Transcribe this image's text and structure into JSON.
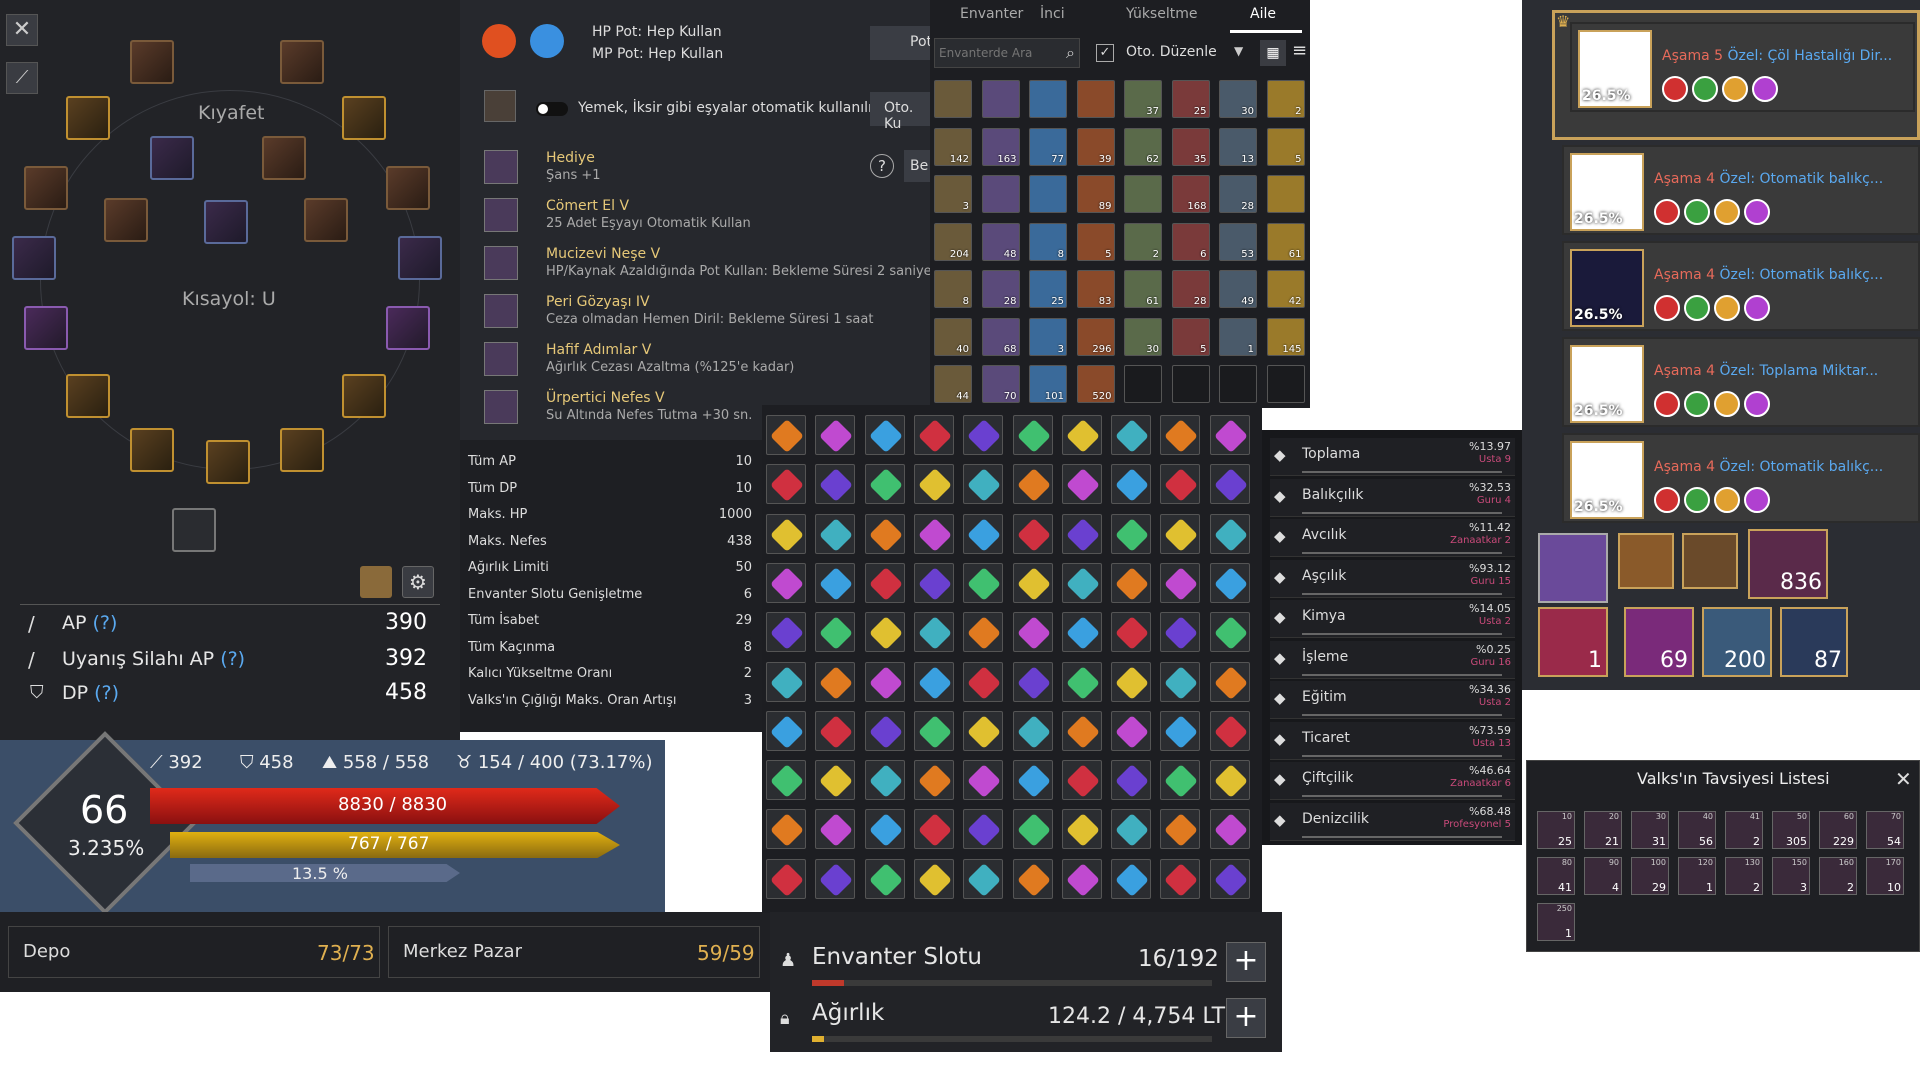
{
  "equipment": {
    "title": "Kıyafet",
    "shortcut": "Kısayol: U"
  },
  "stats": {
    "ap_label": "AP",
    "ap_help": "(?)",
    "ap": "390",
    "awake_label": "Uyanış Silahı AP",
    "awake_help": "(?)",
    "awake": "392",
    "dp_label": "DP",
    "dp_help": "(?)",
    "dp": "458"
  },
  "character": {
    "level": "66",
    "exp": "3.235%",
    "ap": "392",
    "dp": "458",
    "weight": "558 / 558",
    "energy": "154 / 400 (73.17%)",
    "hp": "8830 / 8830",
    "mp": "767 / 767",
    "sub": "13.5 %"
  },
  "storage": {
    "depo_label": "Depo",
    "depo_count": "73/73",
    "market_label": "Merkez Pazar",
    "market_count": "59/59"
  },
  "potion": {
    "hp": "HP Pot: Hep Kullan",
    "mp": "MP Pot: Hep Kullan",
    "pot_button": "Pot",
    "auto_text": "Yemek, İksir gibi eşyalar otomatik kullanılır.",
    "auto_button": "Oto. Ku",
    "help": "?",
    "bec_button": "Be"
  },
  "buffs": [
    {
      "title": "Hediye",
      "desc": "Şans +1"
    },
    {
      "title": "Cömert El V",
      "desc": "25 Adet Eşyayı Otomatik Kullan"
    },
    {
      "title": "Mucizevi Neşe V",
      "desc": "HP/Kaynak Azaldığında Pot Kullan: Bekleme Süresi 2 saniye"
    },
    {
      "title": "Peri Gözyaşı IV",
      "desc": "Ceza olmadan Hemen Diril: Bekleme Süresi 1 saat"
    },
    {
      "title": "Hafif Adımlar V",
      "desc": "Ağırlık Cezası Azaltma (%125'e kadar)"
    },
    {
      "title": "Ürpertici Nefes V",
      "desc": "Su Altında Nefes Tutma +30 sn."
    }
  ],
  "family_stats": [
    {
      "label": "Tüm AP",
      "value": "10"
    },
    {
      "label": "Tüm DP",
      "value": "10"
    },
    {
      "label": "Maks. HP",
      "value": "1000"
    },
    {
      "label": "Maks. Nefes",
      "value": "438"
    },
    {
      "label": "Ağırlık Limiti",
      "value": "50"
    },
    {
      "label": "Envanter Slotu Genişletme",
      "value": "6"
    },
    {
      "label": "Tüm İsabet",
      "value": "29"
    },
    {
      "label": "Tüm Kaçınma",
      "value": "8"
    },
    {
      "label": "Kalıcı Yükseltme Oranı",
      "value": "2"
    },
    {
      "label": "Valks'ın Çığlığı Maks. Oran Artışı",
      "value": "3"
    }
  ],
  "inventory": {
    "tabs": [
      "Envanter",
      "İnci",
      "Yükseltme",
      "Aile"
    ],
    "search_placeholder": "Envanterde Ara",
    "auto_sort": "Oto. Düzenle",
    "counts": [
      "",
      "",
      "",
      "",
      "37",
      "25",
      "30",
      "2",
      "142",
      "163",
      "77",
      "39",
      "62",
      "35",
      "13",
      "5",
      "3",
      "",
      "",
      "89",
      "",
      "168",
      "28",
      "",
      "204",
      "48",
      "8",
      "5",
      "2",
      "6",
      "53",
      "61",
      "8",
      "28",
      "25",
      "83",
      "61",
      "28",
      "49",
      "42",
      "40",
      "68",
      "3",
      "296",
      "30",
      "5",
      "1",
      "145",
      "44",
      "70",
      "101",
      "520"
    ],
    "slot_label": "Envanter Slotu",
    "slot_value": "16/192",
    "weight_label": "Ağırlık",
    "weight_value": "124.2 / 4,754 LT"
  },
  "life_skills": [
    {
      "name": "Toplama",
      "pct": "%13.97",
      "rank": "Usta 9"
    },
    {
      "name": "Balıkçılık",
      "pct": "%32.53",
      "rank": "Guru 4"
    },
    {
      "name": "Avcılık",
      "pct": "%11.42",
      "rank": "Zanaatkar 2"
    },
    {
      "name": "Aşçılık",
      "pct": "%93.12",
      "rank": "Guru 15"
    },
    {
      "name": "Kimya",
      "pct": "%14.05",
      "rank": "Usta 2"
    },
    {
      "name": "İşleme",
      "pct": "%0.25",
      "rank": "Guru 16"
    },
    {
      "name": "Eğitim",
      "pct": "%34.36",
      "rank": "Usta 2"
    },
    {
      "name": "Ticaret",
      "pct": "%73.59",
      "rank": "Usta 13"
    },
    {
      "name": "Çiftçilik",
      "pct": "%46.64",
      "rank": "Zanaatkar 6"
    },
    {
      "name": "Denizcilik",
      "pct": "%68.48",
      "rank": "Profesyonel 5"
    }
  ],
  "pets": [
    {
      "pct": "26.5%",
      "stage": "Aşama 5",
      "skill": "Özel: Çöl Hastalığı Dir..."
    },
    {
      "pct": "26.5%",
      "stage": "Aşama 4",
      "skill": "Özel: Otomatik balıkç..."
    },
    {
      "pct": "26.5%",
      "stage": "Aşama 4",
      "skill": "Özel: Otomatik balıkç..."
    },
    {
      "pct": "26.5%",
      "stage": "Aşama 4",
      "skill": "Özel: Toplama Miktar..."
    },
    {
      "pct": "26.5%",
      "stage": "Aşama 4",
      "skill": "Özel: Otomatik balıkç..."
    }
  ],
  "pet_items": {
    "a": "836",
    "b": "1",
    "c": "69",
    "d": "200",
    "e": "87"
  },
  "valks": {
    "title": "Valks'ın Tavsiyesi Listesi",
    "items": [
      {
        "lvl": "10",
        "n": "25"
      },
      {
        "lvl": "20",
        "n": "21"
      },
      {
        "lvl": "30",
        "n": "31"
      },
      {
        "lvl": "40",
        "n": "56"
      },
      {
        "lvl": "41",
        "n": "2"
      },
      {
        "lvl": "50",
        "n": "305"
      },
      {
        "lvl": "60",
        "n": "229"
      },
      {
        "lvl": "70",
        "n": "54"
      },
      {
        "lvl": "80",
        "n": "41"
      },
      {
        "lvl": "90",
        "n": "4"
      },
      {
        "lvl": "100",
        "n": "29"
      },
      {
        "lvl": "120",
        "n": "1"
      },
      {
        "lvl": "130",
        "n": "2"
      },
      {
        "lvl": "150",
        "n": "3"
      },
      {
        "lvl": "160",
        "n": "2"
      },
      {
        "lvl": "170",
        "n": "10"
      },
      {
        "lvl": "250",
        "n": "1"
      }
    ]
  }
}
